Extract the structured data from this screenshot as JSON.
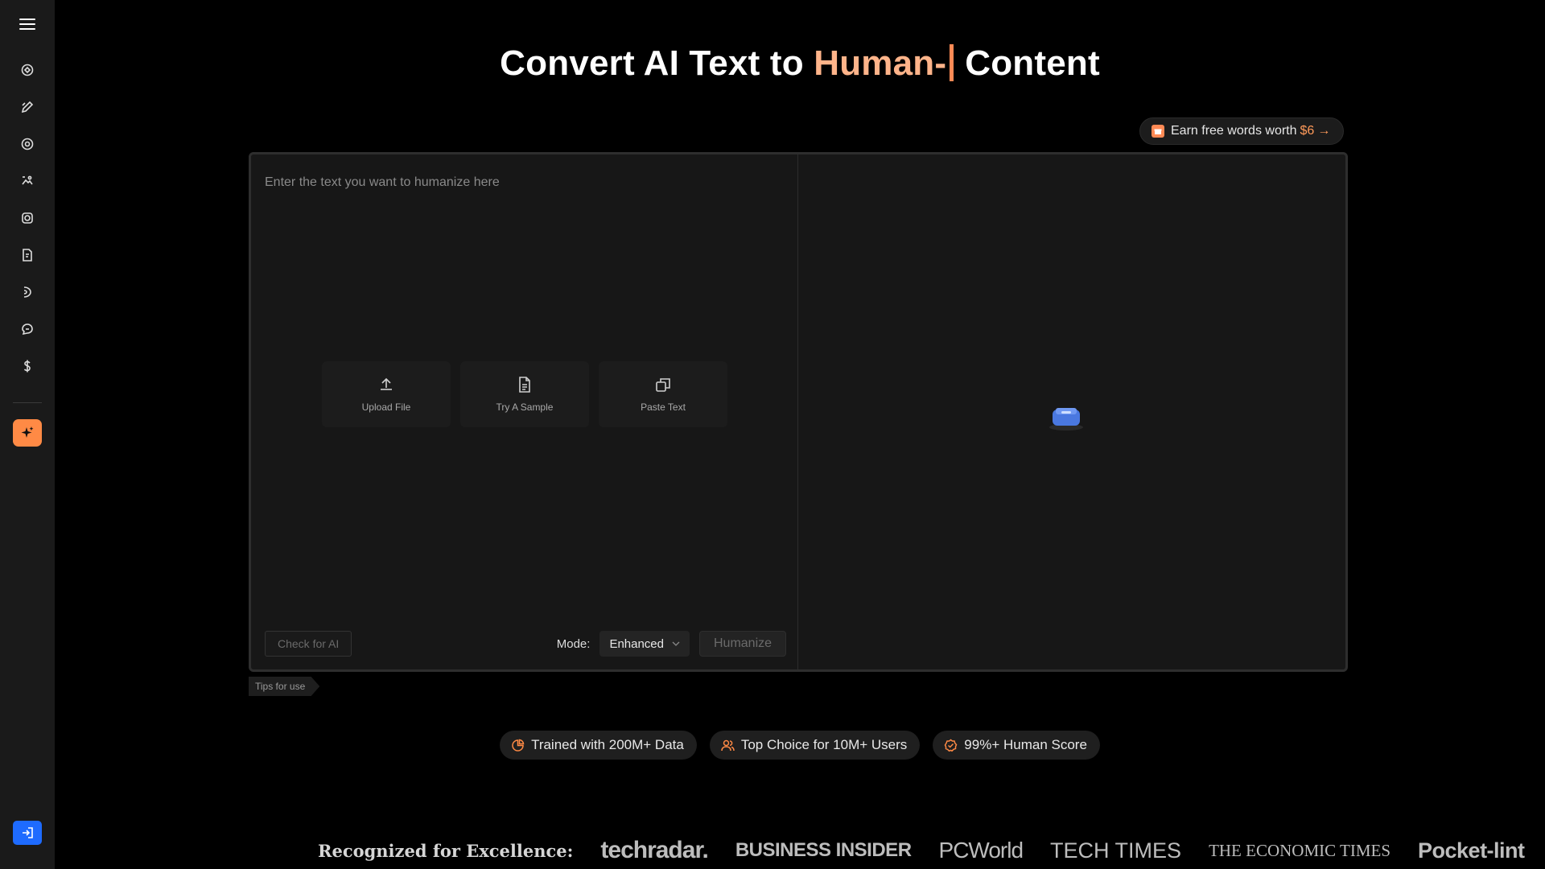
{
  "hero": {
    "title_prefix": "Convert AI Text to",
    "title_highlight": "Human-",
    "title_suffix": "Content"
  },
  "earn": {
    "label": "Earn free words worth",
    "amount": "$6",
    "arrow": "→"
  },
  "editor": {
    "placeholder": "Enter the text you want to humanize here",
    "actions": [
      {
        "label": "Upload File",
        "icon": "upload-icon"
      },
      {
        "label": "Try A Sample",
        "icon": "document-icon"
      },
      {
        "label": "Paste Text",
        "icon": "copy-icon"
      }
    ],
    "check_label": "Check for AI",
    "mode_label": "Mode:",
    "mode_value": "Enhanced",
    "humanize_label": "Humanize"
  },
  "tips_label": "Tips for use",
  "badges": [
    {
      "label": "Trained with 200M+ Data",
      "icon": "chart-pie-icon"
    },
    {
      "label": "Top Choice for 10M+ Users",
      "icon": "users-icon"
    },
    {
      "label": "99%+ Human Score",
      "icon": "check-badge-icon"
    }
  ],
  "recognized": {
    "lead": "Recognized for Excellence:",
    "logos": [
      "techradar.",
      "BUSINESS INSIDER",
      "PCWorld",
      "TECH TIMES",
      "THE ECONOMIC TIMES",
      "Pocket-lint"
    ]
  },
  "sidebar": {
    "items": [
      "humanizer-icon",
      "pen-icon",
      "detector-icon",
      "image-icon",
      "grammar-icon",
      "doc-icon",
      "voice-icon",
      "chat-icon",
      "pricing-icon"
    ]
  },
  "colors": {
    "accent": "#ff8a45",
    "highlight": "#ffb48a",
    "login": "#1e6bff"
  }
}
